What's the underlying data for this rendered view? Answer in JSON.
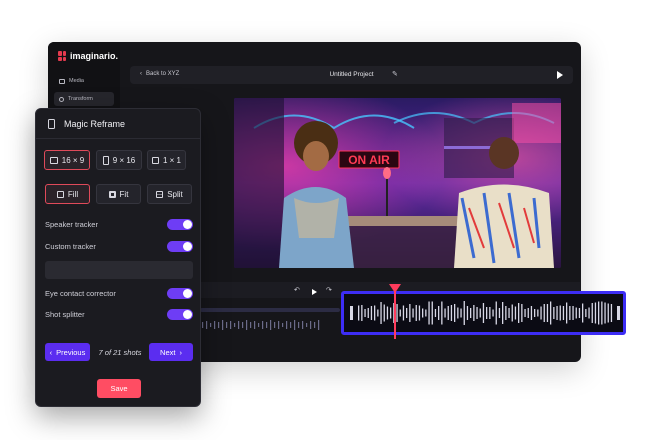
{
  "app": {
    "brand": "imaginario.",
    "sidebar": [
      {
        "label": "Media",
        "icon": "video-icon"
      },
      {
        "label": "Transform",
        "icon": "user-icon"
      }
    ],
    "topbar": {
      "back_label": "Back to XYZ",
      "project_title": "Untitled Project"
    },
    "video": {
      "sign_text": "ON AIR"
    }
  },
  "panel": {
    "title": "Magic Reframe",
    "ratios": [
      {
        "label": "16 × 9",
        "selected": true
      },
      {
        "label": "9 × 16",
        "selected": false
      },
      {
        "label": "1 × 1",
        "selected": false
      }
    ],
    "fit_modes": [
      {
        "label": "Fill",
        "selected": true
      },
      {
        "label": "Fit",
        "selected": false
      },
      {
        "label": "Split",
        "selected": false
      }
    ],
    "speaker_tracker": {
      "label": "Speaker tracker",
      "on": true
    },
    "custom_tracker": {
      "label": "Custom tracker",
      "on": true
    },
    "custom_tracker_value": "",
    "eye_contact": {
      "label": "Eye contact corrector",
      "on": true
    },
    "shot_splitter": {
      "label": "Shot splitter",
      "on": true
    },
    "previous_label": "Previous",
    "next_label": "Next",
    "shots_text": "7 of 21 shots",
    "save_label": "Save"
  },
  "colors": {
    "accent_purple": "#5b2df0",
    "toggle_on": "#6e3df5",
    "save_red": "#ff4d63",
    "playhead": "#ff3b5c",
    "waveform_border": "#3d2df5"
  }
}
